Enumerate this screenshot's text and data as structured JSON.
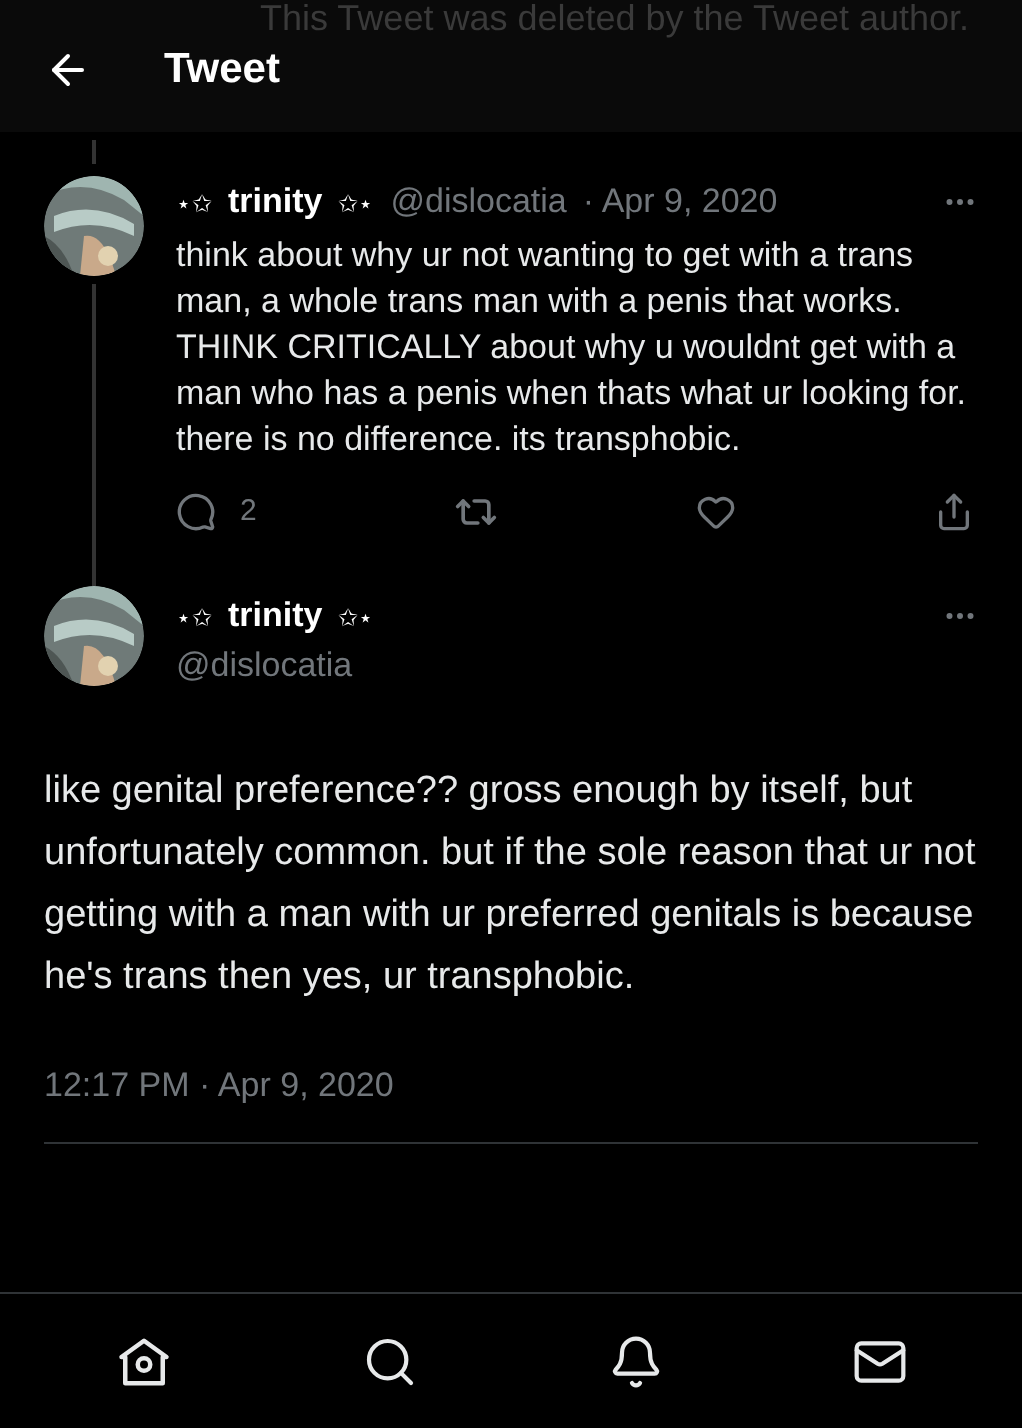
{
  "deleted_notice": "This Tweet was deleted by the Tweet author.",
  "header": {
    "title": "Tweet"
  },
  "parent_tweet": {
    "name_prefix": "⋆✩",
    "name": "trinity",
    "name_suffix": "✩⋆",
    "handle": "@dislocatia",
    "date": "· Apr 9, 2020",
    "text": "think about why ur not wanting to get with a trans man, a whole trans man with a penis that works. THINK CRITICALLY about why u wouldnt get with a man who has a penis when thats what ur looking for. there is no difference. its transphobic.",
    "reply_count": "2",
    "liked": false
  },
  "main_tweet": {
    "name_prefix": "⋆✩",
    "name": "trinity",
    "name_suffix": "✩⋆",
    "handle": "@dislocatia",
    "text": "like genital preference?? gross enough by itself, but unfortunately common. but if the sole reason that ur not getting with a man with ur preferred genitals is because he's trans then yes, ur transphobic.",
    "timestamp": "12:17 PM · Apr 9, 2020"
  },
  "bottom_nav": [
    {
      "kind": "home",
      "selected": false
    },
    {
      "kind": "search",
      "selected": false
    },
    {
      "kind": "notifications",
      "selected": false
    },
    {
      "kind": "messages",
      "selected": false
    }
  ]
}
